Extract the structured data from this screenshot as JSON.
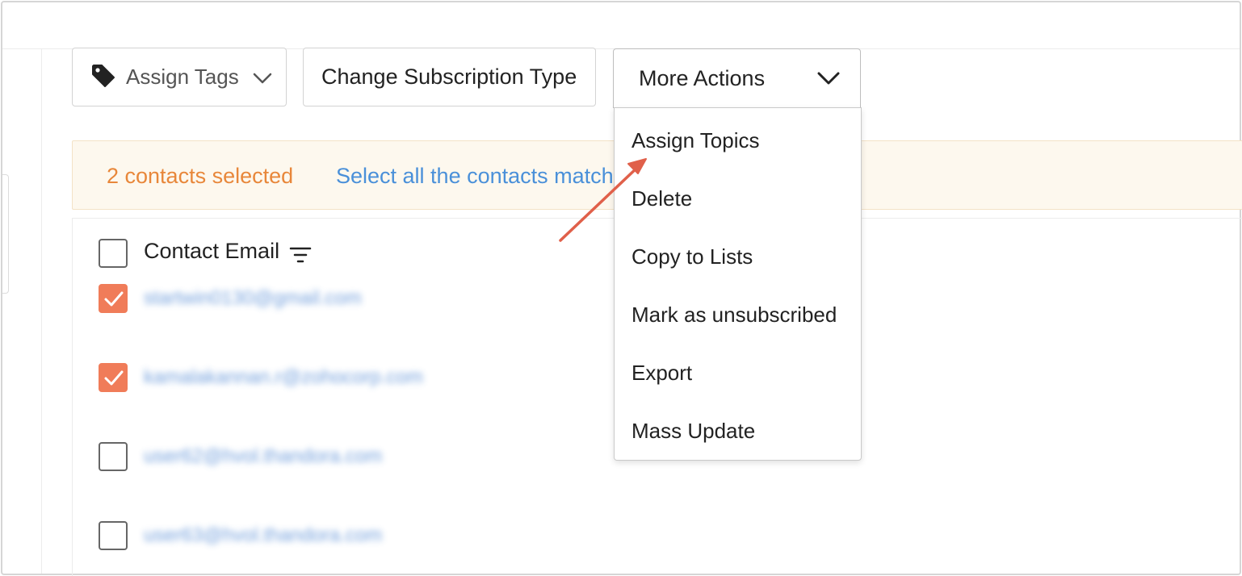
{
  "toolbar": {
    "assign_tags_label": "Assign Tags",
    "change_subscription_label": "Change Subscription Type",
    "more_actions_label": "More Actions"
  },
  "banner": {
    "selected_text": "2 contacts selected",
    "select_all_text": "Select all the contacts match"
  },
  "table": {
    "column_header": "Contact Email",
    "rows": [
      {
        "email": "startwin0130@gmail.com",
        "checked": true
      },
      {
        "email": "kamalakannan.r@zohocorp.com",
        "checked": true
      },
      {
        "email": "user62@hvol.thandora.com",
        "checked": false
      },
      {
        "email": "user63@hvol.thandora.com",
        "checked": false
      }
    ]
  },
  "more_actions_menu": {
    "items": [
      {
        "label": "Assign Topics"
      },
      {
        "label": "Delete"
      },
      {
        "label": "Copy to Lists"
      },
      {
        "label": "Mark as unsubscribed"
      },
      {
        "label": "Export"
      },
      {
        "label": "Mass Update"
      }
    ]
  },
  "colors": {
    "accent_orange": "#e8873a",
    "checkbox_checked": "#f07c59",
    "link_blue": "#4a90d9",
    "banner_bg": "#fdf8ee",
    "annotation_arrow": "#e0604a"
  },
  "icons": {
    "tag": "tag-icon",
    "chevron": "chevron-down-icon",
    "filter": "filter-icon",
    "check": "checkmark-icon"
  }
}
